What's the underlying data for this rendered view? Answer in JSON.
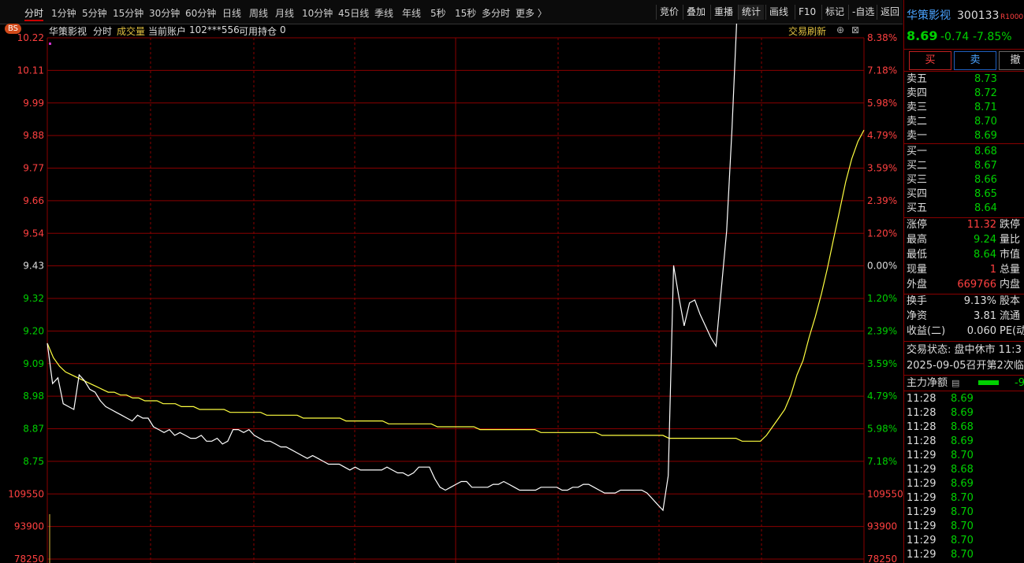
{
  "toolbar": {
    "timeframes": [
      "分时",
      "1分钟",
      "5分钟",
      "15分钟",
      "30分钟",
      "60分钟",
      "日线",
      "周线",
      "月线",
      "10分钟",
      "45日线",
      "季线",
      "年线",
      "5秒",
      "15秒",
      "多分时",
      "更多 〉"
    ],
    "right_buttons": [
      "竞价",
      "叠加",
      "重播",
      "统计",
      "画线",
      "F10",
      "标记",
      "-自选",
      "返回"
    ]
  },
  "chart_header": {
    "bs_badge": "BS",
    "stock_name": "华策影视",
    "mode": "分时",
    "volume_label": "成交量",
    "account_label": "当前账户",
    "account_id": "102***556",
    "position_label": "可用持仓",
    "position_value": "0",
    "refresh_label": "交易刷新",
    "plus_glyph": "⊕",
    "close_glyph": "⊠"
  },
  "chart_data": {
    "type": "line",
    "title": "",
    "price_ticks": [
      "10.22",
      "10.11",
      "9.99",
      "9.88",
      "9.77",
      "9.66",
      "9.54",
      "9.43",
      "9.32",
      "9.20",
      "9.09",
      "8.98",
      "8.87",
      "8.75"
    ],
    "pct_ticks": [
      "8.38%",
      "7.18%",
      "5.98%",
      "4.79%",
      "3.59%",
      "2.39%",
      "1.20%",
      "0.00%",
      "1.20%",
      "2.39%",
      "3.59%",
      "4.79%",
      "5.98%",
      "7.18%"
    ],
    "volume_ticks": [
      "109550",
      "93900",
      "78250"
    ],
    "prev_close": 9.43,
    "ylim": [
      8.69,
      10.28
    ],
    "series": [
      {
        "values": [
          9.16,
          9.02,
          9.04,
          8.95,
          8.94,
          8.93,
          9.05,
          9.03,
          9.0,
          8.99,
          8.96,
          8.94,
          8.93,
          8.92,
          8.91,
          8.9,
          8.89,
          8.91,
          8.9,
          8.9,
          8.87,
          8.86,
          8.85,
          8.86,
          8.84,
          8.85,
          8.84,
          8.83,
          8.83,
          8.84,
          8.82,
          8.82,
          8.83,
          8.81,
          8.82,
          8.86,
          8.86,
          8.85,
          8.86,
          8.84,
          8.83,
          8.82,
          8.82,
          8.81,
          8.8,
          8.8,
          8.79,
          8.78,
          8.77,
          8.76,
          8.77,
          8.76,
          8.75,
          8.74,
          8.74,
          8.74,
          8.73,
          8.72,
          8.73,
          8.72,
          8.72,
          8.72,
          8.72,
          8.72,
          8.73,
          8.72,
          8.71,
          8.71,
          8.7,
          8.71,
          8.73,
          8.73,
          8.73,
          8.69,
          8.66,
          8.65,
          8.66,
          8.67,
          8.68,
          8.68,
          8.66,
          8.66,
          8.66,
          8.66,
          8.67,
          8.67,
          8.68,
          8.67,
          8.66,
          8.65,
          8.65,
          8.65,
          8.65,
          8.66,
          8.66,
          8.66,
          8.66,
          8.65,
          8.65,
          8.66,
          8.66,
          8.67,
          8.67,
          8.66,
          8.65,
          8.64,
          8.64,
          8.64,
          8.65,
          8.65,
          8.65,
          8.65,
          8.65,
          8.64,
          8.62,
          8.6,
          8.58,
          8.7,
          9.43,
          9.32,
          9.22,
          9.3,
          9.31,
          9.26,
          9.22,
          9.18,
          9.15,
          9.35,
          9.55,
          9.9,
          10.5,
          11.3
        ]
      },
      {
        "values": [
          9.16,
          9.11,
          9.08,
          9.06,
          9.05,
          9.04,
          9.03,
          9.02,
          9.01,
          9.0,
          8.99,
          8.99,
          8.98,
          8.98,
          8.97,
          8.97,
          8.96,
          8.96,
          8.96,
          8.95,
          8.95,
          8.95,
          8.94,
          8.94,
          8.94,
          8.93,
          8.93,
          8.93,
          8.93,
          8.93,
          8.92,
          8.92,
          8.92,
          8.92,
          8.92,
          8.92,
          8.91,
          8.91,
          8.91,
          8.91,
          8.91,
          8.91,
          8.9,
          8.9,
          8.9,
          8.9,
          8.9,
          8.9,
          8.9,
          8.89,
          8.89,
          8.89,
          8.89,
          8.89,
          8.89,
          8.89,
          8.88,
          8.88,
          8.88,
          8.88,
          8.88,
          8.88,
          8.88,
          8.88,
          8.87,
          8.87,
          8.87,
          8.87,
          8.87,
          8.87,
          8.87,
          8.86,
          8.86,
          8.86,
          8.86,
          8.86,
          8.86,
          8.86,
          8.86,
          8.86,
          8.86,
          8.85,
          8.85,
          8.85,
          8.85,
          8.85,
          8.85,
          8.85,
          8.85,
          8.85,
          8.85,
          8.84,
          8.84,
          8.84,
          8.84,
          8.84,
          8.84,
          8.84,
          8.84,
          8.84,
          8.84,
          8.84,
          8.83,
          8.83,
          8.83,
          8.83,
          8.83,
          8.83,
          8.83,
          8.83,
          8.83,
          8.83,
          8.83,
          8.83,
          8.82,
          8.82,
          8.82,
          8.82,
          8.84,
          8.87,
          8.9,
          8.93,
          8.98,
          9.05,
          9.1,
          9.18,
          9.25,
          9.33,
          9.42,
          9.52,
          9.62,
          9.72,
          9.8,
          9.86,
          9.9
        ]
      }
    ]
  },
  "panel": {
    "name": "华策影视",
    "code": "300133",
    "badge": "R1000",
    "price": "8.69",
    "change": "-0.74",
    "change_pct": "-7.85%",
    "buy_button": "买",
    "sell_button": "卖",
    "cancel_button": "撤",
    "asks": [
      {
        "label": "卖五",
        "price": "8.73"
      },
      {
        "label": "卖四",
        "price": "8.72"
      },
      {
        "label": "卖三",
        "price": "8.71"
      },
      {
        "label": "卖二",
        "price": "8.70"
      },
      {
        "label": "卖一",
        "price": "8.69"
      }
    ],
    "bids": [
      {
        "label": "买一",
        "price": "8.68"
      },
      {
        "label": "买二",
        "price": "8.67"
      },
      {
        "label": "买三",
        "price": "8.66"
      },
      {
        "label": "买四",
        "price": "8.65"
      },
      {
        "label": "买五",
        "price": "8.64"
      }
    ],
    "stats_a": [
      {
        "label": "涨停",
        "value": "11.32",
        "color": "#ff4040",
        "label2": "跌停"
      },
      {
        "label": "最高",
        "value": "9.24",
        "color": "#00d000",
        "label2": "量比"
      },
      {
        "label": "最低",
        "value": "8.64",
        "color": "#00d000",
        "label2": "市值"
      },
      {
        "label": "现量",
        "value": "1",
        "color": "#ff4040",
        "label2": "总量"
      },
      {
        "label": "外盘",
        "value": "669766",
        "color": "#ff4040",
        "label2": "内盘"
      }
    ],
    "stats_b": [
      {
        "label": "换手",
        "value": "9.13%",
        "label2": "股本"
      },
      {
        "label": "净资",
        "value": "3.81",
        "label2": "流通"
      },
      {
        "label": "收益(二)",
        "value": "0.060",
        "label2": "PE(动"
      }
    ],
    "trade_status": "交易状态: 盘中休市 11:3",
    "notice": "2025-09-05召开第2次临",
    "main_flow_label": "主力净额",
    "main_flow_value": "-9",
    "ticks": [
      {
        "time": "11:28",
        "price": "8.69"
      },
      {
        "time": "11:28",
        "price": "8.69"
      },
      {
        "time": "11:28",
        "price": "8.68"
      },
      {
        "time": "11:28",
        "price": "8.69"
      },
      {
        "time": "11:29",
        "price": "8.70"
      },
      {
        "time": "11:29",
        "price": "8.68"
      },
      {
        "time": "11:29",
        "price": "8.69"
      },
      {
        "time": "11:29",
        "price": "8.70"
      },
      {
        "time": "11:29",
        "price": "8.70"
      },
      {
        "time": "11:29",
        "price": "8.70"
      },
      {
        "time": "11:29",
        "price": "8.70"
      },
      {
        "time": "11:29",
        "price": "8.70"
      }
    ]
  },
  "colors": {
    "up": "#ff4040",
    "down": "#00d000",
    "grid": "#8a0000",
    "price_line": "#ffffff",
    "avg_line": "#ffff40",
    "accent": "#4aa3ff"
  }
}
